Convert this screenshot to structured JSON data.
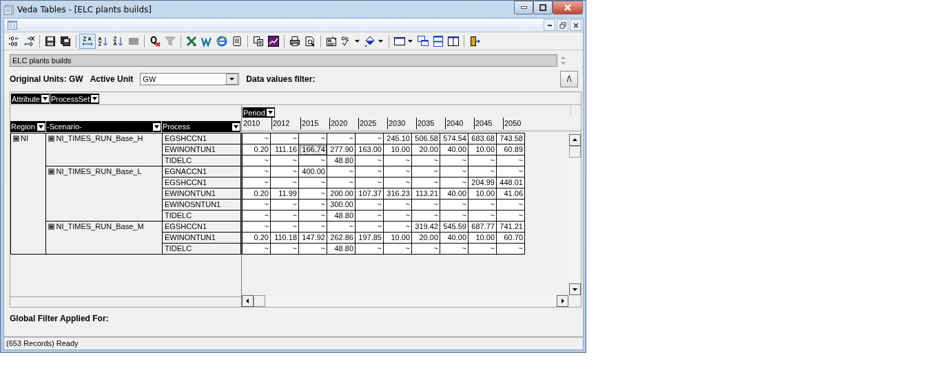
{
  "window": {
    "title": "Veda Tables - [ELC plants builds]"
  },
  "toolbar": {
    "sort_toggle_on": true
  },
  "view_title": "ELC plants builds",
  "units": {
    "original_label": "Original Units: GW",
    "active_label": "Active Unit",
    "active_value": "GW",
    "filter_label": "Data values filter:"
  },
  "collapse_button": "/\\",
  "column_fields": [
    "Attribute",
    "ProcessSet"
  ],
  "period_field": "Period",
  "row_fields": [
    "Region",
    "-Scenario-",
    "Process"
  ],
  "periods": [
    "2010",
    "2012",
    "2015",
    "2020",
    "2025",
    "2030",
    "2035",
    "2040",
    "2045",
    "2050"
  ],
  "regions": [
    {
      "name": "NI",
      "expanded": true,
      "children": [
        {
          "name": "NI_TIMES_RUN_Base_H",
          "expanded": true,
          "children": [
            {
              "process": "EGSHCCN1",
              "cells": [
                {
                  "text": "~",
                  "selected": false
                },
                {
                  "text": "~",
                  "selected": false
                },
                {
                  "text": "~",
                  "selected": false
                },
                {
                  "text": "~",
                  "selected": false
                },
                {
                  "text": "~",
                  "selected": false
                },
                {
                  "text": "245.10",
                  "selected": false
                },
                {
                  "text": "506.58",
                  "selected": false
                },
                {
                  "text": "574.54",
                  "selected": false
                },
                {
                  "text": "683.68",
                  "selected": false
                },
                {
                  "text": "743.58",
                  "selected": false
                }
              ]
            },
            {
              "process": "EWINONTUN1",
              "cells": [
                {
                  "text": "0.20",
                  "selected": false
                },
                {
                  "text": "111.16",
                  "selected": false
                },
                {
                  "text": "166.74",
                  "selected": true
                },
                {
                  "text": "277.90",
                  "selected": false
                },
                {
                  "text": "163.00",
                  "selected": false
                },
                {
                  "text": "10.00",
                  "selected": false
                },
                {
                  "text": "20.00",
                  "selected": false
                },
                {
                  "text": "40.00",
                  "selected": false
                },
                {
                  "text": "10.00",
                  "selected": false
                },
                {
                  "text": "60.89",
                  "selected": false
                }
              ]
            },
            {
              "process": "TIDELC",
              "cells": [
                {
                  "text": "~",
                  "selected": false
                },
                {
                  "text": "~",
                  "selected": false
                },
                {
                  "text": "~",
                  "selected": false
                },
                {
                  "text": "48.80",
                  "selected": false
                },
                {
                  "text": "~",
                  "selected": false
                },
                {
                  "text": "~",
                  "selected": false
                },
                {
                  "text": "~",
                  "selected": false
                },
                {
                  "text": "~",
                  "selected": false
                },
                {
                  "text": "~",
                  "selected": false
                },
                {
                  "text": "~",
                  "selected": false
                }
              ]
            }
          ]
        },
        {
          "name": "NI_TIMES_RUN_Base_L",
          "expanded": true,
          "children": [
            {
              "process": "EGNACCN1",
              "cells": [
                {
                  "text": "~",
                  "selected": false
                },
                {
                  "text": "~",
                  "selected": false
                },
                {
                  "text": "400.00",
                  "selected": false
                },
                {
                  "text": "~",
                  "selected": false
                },
                {
                  "text": "~",
                  "selected": false
                },
                {
                  "text": "~",
                  "selected": false
                },
                {
                  "text": "~",
                  "selected": false
                },
                {
                  "text": "~",
                  "selected": false
                },
                {
                  "text": "~",
                  "selected": false
                },
                {
                  "text": "~",
                  "selected": false
                }
              ]
            },
            {
              "process": "EGSHCCN1",
              "cells": [
                {
                  "text": "~",
                  "selected": false
                },
                {
                  "text": "~",
                  "selected": false
                },
                {
                  "text": "~",
                  "selected": false
                },
                {
                  "text": "~",
                  "selected": false
                },
                {
                  "text": "~",
                  "selected": false
                },
                {
                  "text": "~",
                  "selected": false
                },
                {
                  "text": "~",
                  "selected": false
                },
                {
                  "text": "~",
                  "selected": false
                },
                {
                  "text": "204.99",
                  "selected": false
                },
                {
                  "text": "448.01",
                  "selected": false
                }
              ]
            },
            {
              "process": "EWINONTUN1",
              "cells": [
                {
                  "text": "0.20",
                  "selected": false
                },
                {
                  "text": "11.99",
                  "selected": false
                },
                {
                  "text": "~",
                  "selected": false
                },
                {
                  "text": "200.00",
                  "selected": false
                },
                {
                  "text": "107.37",
                  "selected": false
                },
                {
                  "text": "316.23",
                  "selected": false
                },
                {
                  "text": "113.21",
                  "selected": false
                },
                {
                  "text": "40.00",
                  "selected": false
                },
                {
                  "text": "10.00",
                  "selected": false
                },
                {
                  "text": "41.06",
                  "selected": false
                }
              ]
            },
            {
              "process": "EWINOSNTUN1",
              "cells": [
                {
                  "text": "~",
                  "selected": false
                },
                {
                  "text": "~",
                  "selected": false
                },
                {
                  "text": "~",
                  "selected": false
                },
                {
                  "text": "300.00",
                  "selected": false
                },
                {
                  "text": "~",
                  "selected": false
                },
                {
                  "text": "~",
                  "selected": false
                },
                {
                  "text": "~",
                  "selected": false
                },
                {
                  "text": "~",
                  "selected": false
                },
                {
                  "text": "~",
                  "selected": false
                },
                {
                  "text": "~",
                  "selected": false
                }
              ]
            },
            {
              "process": "TIDELC",
              "cells": [
                {
                  "text": "~",
                  "selected": false
                },
                {
                  "text": "~",
                  "selected": false
                },
                {
                  "text": "~",
                  "selected": false
                },
                {
                  "text": "48.80",
                  "selected": false
                },
                {
                  "text": "~",
                  "selected": false
                },
                {
                  "text": "~",
                  "selected": false
                },
                {
                  "text": "~",
                  "selected": false
                },
                {
                  "text": "~",
                  "selected": false
                },
                {
                  "text": "~",
                  "selected": false
                },
                {
                  "text": "~",
                  "selected": false
                }
              ]
            }
          ]
        },
        {
          "name": "NI_TIMES_RUN_Base_M",
          "expanded": true,
          "children": [
            {
              "process": "EGSHCCN1",
              "cells": [
                {
                  "text": "~",
                  "selected": false
                },
                {
                  "text": "~",
                  "selected": false
                },
                {
                  "text": "~",
                  "selected": false
                },
                {
                  "text": "~",
                  "selected": false
                },
                {
                  "text": "~",
                  "selected": false
                },
                {
                  "text": "~",
                  "selected": false
                },
                {
                  "text": "319.42",
                  "selected": false
                },
                {
                  "text": "545.59",
                  "selected": false
                },
                {
                  "text": "687.77",
                  "selected": false
                },
                {
                  "text": "741.21",
                  "selected": false
                }
              ]
            },
            {
              "process": "EWINONTUN1",
              "cells": [
                {
                  "text": "0.20",
                  "selected": false
                },
                {
                  "text": "110.18",
                  "selected": false
                },
                {
                  "text": "147.92",
                  "selected": false
                },
                {
                  "text": "262.86",
                  "selected": false
                },
                {
                  "text": "197.85",
                  "selected": false
                },
                {
                  "text": "10.00",
                  "selected": false
                },
                {
                  "text": "20.00",
                  "selected": false
                },
                {
                  "text": "40.00",
                  "selected": false
                },
                {
                  "text": "10.00",
                  "selected": false
                },
                {
                  "text": "60.70",
                  "selected": false
                }
              ]
            },
            {
              "process": "TIDELC",
              "cells": [
                {
                  "text": "~",
                  "selected": false
                },
                {
                  "text": "~",
                  "selected": false
                },
                {
                  "text": "~",
                  "selected": false
                },
                {
                  "text": "48.80",
                  "selected": false
                },
                {
                  "text": "~",
                  "selected": false
                },
                {
                  "text": "~",
                  "selected": false
                },
                {
                  "text": "~",
                  "selected": false
                },
                {
                  "text": "~",
                  "selected": false
                },
                {
                  "text": "~",
                  "selected": false
                },
                {
                  "text": "~",
                  "selected": false
                }
              ]
            }
          ]
        }
      ]
    }
  ],
  "global_filter_label": "Global Filter Applied For:",
  "status_bar": "(653 Records) Ready"
}
